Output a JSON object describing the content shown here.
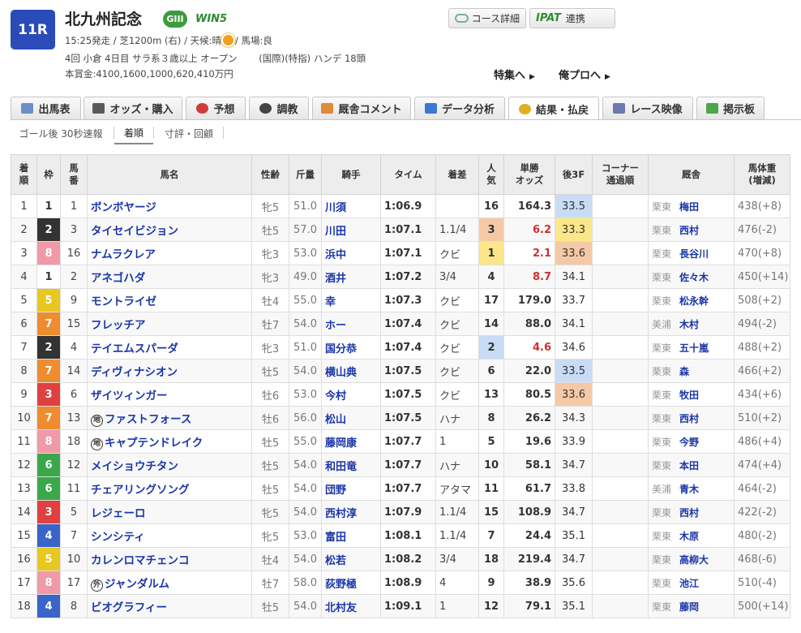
{
  "race": {
    "number": "11R",
    "name": "北九州記念",
    "grade": "GIII",
    "win5": "WIN5",
    "line1_pre": "15:25発走 / 芝1200m (右) / 天候:晴",
    "line1_post": "/ 馬場:良",
    "line2": "4回 小倉 4日目 サラ系３歳以上 オープン　 　(国際)(特指) ハンデ 18頭",
    "line3": "本賞金:4100,1600,1000,620,410万円"
  },
  "buttons": {
    "course": "コース詳細",
    "ipat": "IPAT",
    "ipat_label": "連携",
    "feature": "特集へ",
    "orepro": "俺プロへ"
  },
  "tabs": [
    {
      "label": "出馬表",
      "icon": "table-icon",
      "color": "#6a8fc9"
    },
    {
      "label": "オッズ・購入",
      "icon": "odds-icon",
      "color": "#5a5a5a"
    },
    {
      "label": "予想",
      "icon": "target-icon",
      "color": "#d33a3a"
    },
    {
      "label": "調教",
      "icon": "stopwatch-icon",
      "color": "#444444"
    },
    {
      "label": "厩舎コメント",
      "icon": "stable-icon",
      "color": "#e08a3a"
    },
    {
      "label": "データ分析",
      "icon": "bar-chart-icon",
      "color": "#3a7ad0"
    },
    {
      "label": "結果・払戻",
      "icon": "coins-icon",
      "color": "#e0b020"
    },
    {
      "label": "レース映像",
      "icon": "video-icon",
      "color": "#6a7ab0"
    },
    {
      "label": "掲示板",
      "icon": "chat-icon",
      "color": "#4aa84a"
    }
  ],
  "subtabs": [
    "ゴール後 30秒速報",
    "着順",
    "寸評・回顧"
  ],
  "headers": [
    "着\n順",
    "枠",
    "馬\n番",
    "馬名",
    "性齢",
    "斤量",
    "騎手",
    "タイム",
    "着差",
    "人\n気",
    "単勝\nオッズ",
    "後3F",
    "コーナー\n通過順",
    "厩舎",
    "馬体重\n(増減)"
  ],
  "waku_colors": {
    "1": {
      "bg": "#ffffff",
      "fg": "#333333"
    },
    "2": {
      "bg": "#333333",
      "fg": "#ffffff"
    },
    "3": {
      "bg": "#e04040",
      "fg": "#ffffff"
    },
    "4": {
      "bg": "#3a64c8",
      "fg": "#ffffff"
    },
    "5": {
      "bg": "#e8c820",
      "fg": "#ffffff"
    },
    "6": {
      "bg": "#3aa84a",
      "fg": "#ffffff"
    },
    "7": {
      "bg": "#f08c30",
      "fg": "#ffffff"
    },
    "8": {
      "bg": "#f09aa8",
      "fg": "#ffffff"
    }
  },
  "rank_colors": {
    "1": "#fbe78a",
    "2": "#c9dcf5",
    "3": "#f5c9a5"
  },
  "rows": [
    {
      "pos": "1",
      "waku": "1",
      "num": "1",
      "mark": "",
      "name": "ボンボヤージ",
      "sex": "牝5",
      "wt": "51.0",
      "jockey": "川須",
      "time": "1:06.9",
      "margin": "",
      "pop": "16",
      "odds": "164.3",
      "last3f": "33.5",
      "l3rank": "2",
      "corner": "",
      "region": "栗東",
      "trainer": "梅田",
      "body": "438(+8)"
    },
    {
      "pos": "2",
      "waku": "2",
      "num": "3",
      "mark": "",
      "name": "タイセイビジョン",
      "sex": "牡5",
      "wt": "57.0",
      "jockey": "川田",
      "time": "1:07.1",
      "margin": "1.1/4",
      "pop": "3",
      "odds": "6.2",
      "last3f": "33.3",
      "l3rank": "1",
      "corner": "",
      "region": "栗東",
      "trainer": "西村",
      "body": "476(-2)"
    },
    {
      "pos": "3",
      "waku": "8",
      "num": "16",
      "mark": "",
      "name": "ナムラクレア",
      "sex": "牝3",
      "wt": "53.0",
      "jockey": "浜中",
      "time": "1:07.1",
      "margin": "クビ",
      "pop": "1",
      "odds": "2.1",
      "last3f": "33.6",
      "l3rank": "3",
      "corner": "",
      "region": "栗東",
      "trainer": "長谷川",
      "body": "470(+8)"
    },
    {
      "pos": "4",
      "waku": "1",
      "num": "2",
      "mark": "",
      "name": "アネゴハダ",
      "sex": "牝3",
      "wt": "49.0",
      "jockey": "酒井",
      "time": "1:07.2",
      "margin": "3/4",
      "pop": "4",
      "odds": "8.7",
      "last3f": "34.1",
      "l3rank": "",
      "corner": "",
      "region": "栗東",
      "trainer": "佐々木",
      "body": "450(+14)"
    },
    {
      "pos": "5",
      "waku": "5",
      "num": "9",
      "mark": "",
      "name": "モントライゼ",
      "sex": "牡4",
      "wt": "55.0",
      "jockey": "幸",
      "time": "1:07.3",
      "margin": "クビ",
      "pop": "17",
      "odds": "179.0",
      "last3f": "33.7",
      "l3rank": "",
      "corner": "",
      "region": "栗東",
      "trainer": "松永幹",
      "body": "508(+2)"
    },
    {
      "pos": "6",
      "waku": "7",
      "num": "15",
      "mark": "",
      "name": "フレッチア",
      "sex": "牡7",
      "wt": "54.0",
      "jockey": "ホー",
      "time": "1:07.4",
      "margin": "クビ",
      "pop": "14",
      "odds": "88.0",
      "last3f": "34.1",
      "l3rank": "",
      "corner": "",
      "region": "美浦",
      "trainer": "木村",
      "body": "494(-2)"
    },
    {
      "pos": "7",
      "waku": "2",
      "num": "4",
      "mark": "",
      "name": "テイエムスパーダ",
      "sex": "牝3",
      "wt": "51.0",
      "jockey": "国分恭",
      "time": "1:07.4",
      "margin": "クビ",
      "pop": "2",
      "odds": "4.6",
      "last3f": "34.6",
      "l3rank": "",
      "corner": "",
      "region": "栗東",
      "trainer": "五十嵐",
      "body": "488(+2)"
    },
    {
      "pos": "8",
      "waku": "7",
      "num": "14",
      "mark": "",
      "name": "ディヴィナシオン",
      "sex": "牡5",
      "wt": "54.0",
      "jockey": "横山典",
      "time": "1:07.5",
      "margin": "クビ",
      "pop": "6",
      "odds": "22.0",
      "last3f": "33.5",
      "l3rank": "2",
      "corner": "",
      "region": "栗東",
      "trainer": "森",
      "body": "466(+2)"
    },
    {
      "pos": "9",
      "waku": "3",
      "num": "6",
      "mark": "",
      "name": "ザイツィンガー",
      "sex": "牡6",
      "wt": "53.0",
      "jockey": "今村",
      "time": "1:07.5",
      "margin": "クビ",
      "pop": "13",
      "odds": "80.5",
      "last3f": "33.6",
      "l3rank": "3",
      "corner": "",
      "region": "栗東",
      "trainer": "牧田",
      "body": "434(+6)"
    },
    {
      "pos": "10",
      "waku": "7",
      "num": "13",
      "mark": "地",
      "name": "ファストフォース",
      "sex": "牡6",
      "wt": "56.0",
      "jockey": "松山",
      "time": "1:07.5",
      "margin": "ハナ",
      "pop": "8",
      "odds": "26.2",
      "last3f": "34.3",
      "l3rank": "",
      "corner": "",
      "region": "栗東",
      "trainer": "西村",
      "body": "510(+2)"
    },
    {
      "pos": "11",
      "waku": "8",
      "num": "18",
      "mark": "地",
      "name": "キャプテンドレイク",
      "sex": "牡5",
      "wt": "55.0",
      "jockey": "藤岡康",
      "time": "1:07.7",
      "margin": "1",
      "pop": "5",
      "odds": "19.6",
      "last3f": "33.9",
      "l3rank": "",
      "corner": "",
      "region": "栗東",
      "trainer": "今野",
      "body": "486(+4)"
    },
    {
      "pos": "12",
      "waku": "6",
      "num": "12",
      "mark": "",
      "name": "メイショウチタン",
      "sex": "牡5",
      "wt": "54.0",
      "jockey": "和田竜",
      "time": "1:07.7",
      "margin": "ハナ",
      "pop": "10",
      "odds": "58.1",
      "last3f": "34.7",
      "l3rank": "",
      "corner": "",
      "region": "栗東",
      "trainer": "本田",
      "body": "474(+4)"
    },
    {
      "pos": "13",
      "waku": "6",
      "num": "11",
      "mark": "",
      "name": "チェアリングソング",
      "sex": "牡5",
      "wt": "54.0",
      "jockey": "団野",
      "time": "1:07.7",
      "margin": "アタマ",
      "pop": "11",
      "odds": "61.7",
      "last3f": "33.8",
      "l3rank": "",
      "corner": "",
      "region": "美浦",
      "trainer": "青木",
      "body": "464(-2)"
    },
    {
      "pos": "14",
      "waku": "3",
      "num": "5",
      "mark": "",
      "name": "レジェーロ",
      "sex": "牝5",
      "wt": "54.0",
      "jockey": "西村淳",
      "time": "1:07.9",
      "margin": "1.1/4",
      "pop": "15",
      "odds": "108.9",
      "last3f": "34.7",
      "l3rank": "",
      "corner": "",
      "region": "栗東",
      "trainer": "西村",
      "body": "422(-2)"
    },
    {
      "pos": "15",
      "waku": "4",
      "num": "7",
      "mark": "",
      "name": "シンシティ",
      "sex": "牝5",
      "wt": "53.0",
      "jockey": "富田",
      "time": "1:08.1",
      "margin": "1.1/4",
      "pop": "7",
      "odds": "24.4",
      "last3f": "35.1",
      "l3rank": "",
      "corner": "",
      "region": "栗東",
      "trainer": "木原",
      "body": "480(-2)"
    },
    {
      "pos": "16",
      "waku": "5",
      "num": "10",
      "mark": "",
      "name": "カレンロマチェンコ",
      "sex": "牡4",
      "wt": "54.0",
      "jockey": "松若",
      "time": "1:08.2",
      "margin": "3/4",
      "pop": "18",
      "odds": "219.4",
      "last3f": "34.7",
      "l3rank": "",
      "corner": "",
      "region": "栗東",
      "trainer": "高柳大",
      "body": "468(-6)"
    },
    {
      "pos": "17",
      "waku": "8",
      "num": "17",
      "mark": "外",
      "name": "ジャンダルム",
      "sex": "牡7",
      "wt": "58.0",
      "jockey": "荻野極",
      "time": "1:08.9",
      "margin": "4",
      "pop": "9",
      "odds": "38.9",
      "last3f": "35.6",
      "l3rank": "",
      "corner": "",
      "region": "栗東",
      "trainer": "池江",
      "body": "510(-4)"
    },
    {
      "pos": "18",
      "waku": "4",
      "num": "8",
      "mark": "",
      "name": "ビオグラフィー",
      "sex": "牡5",
      "wt": "54.0",
      "jockey": "北村友",
      "time": "1:09.1",
      "margin": "1",
      "pop": "12",
      "odds": "79.1",
      "last3f": "35.1",
      "l3rank": "",
      "corner": "",
      "region": "栗東",
      "trainer": "藤岡",
      "body": "500(+14)"
    }
  ]
}
